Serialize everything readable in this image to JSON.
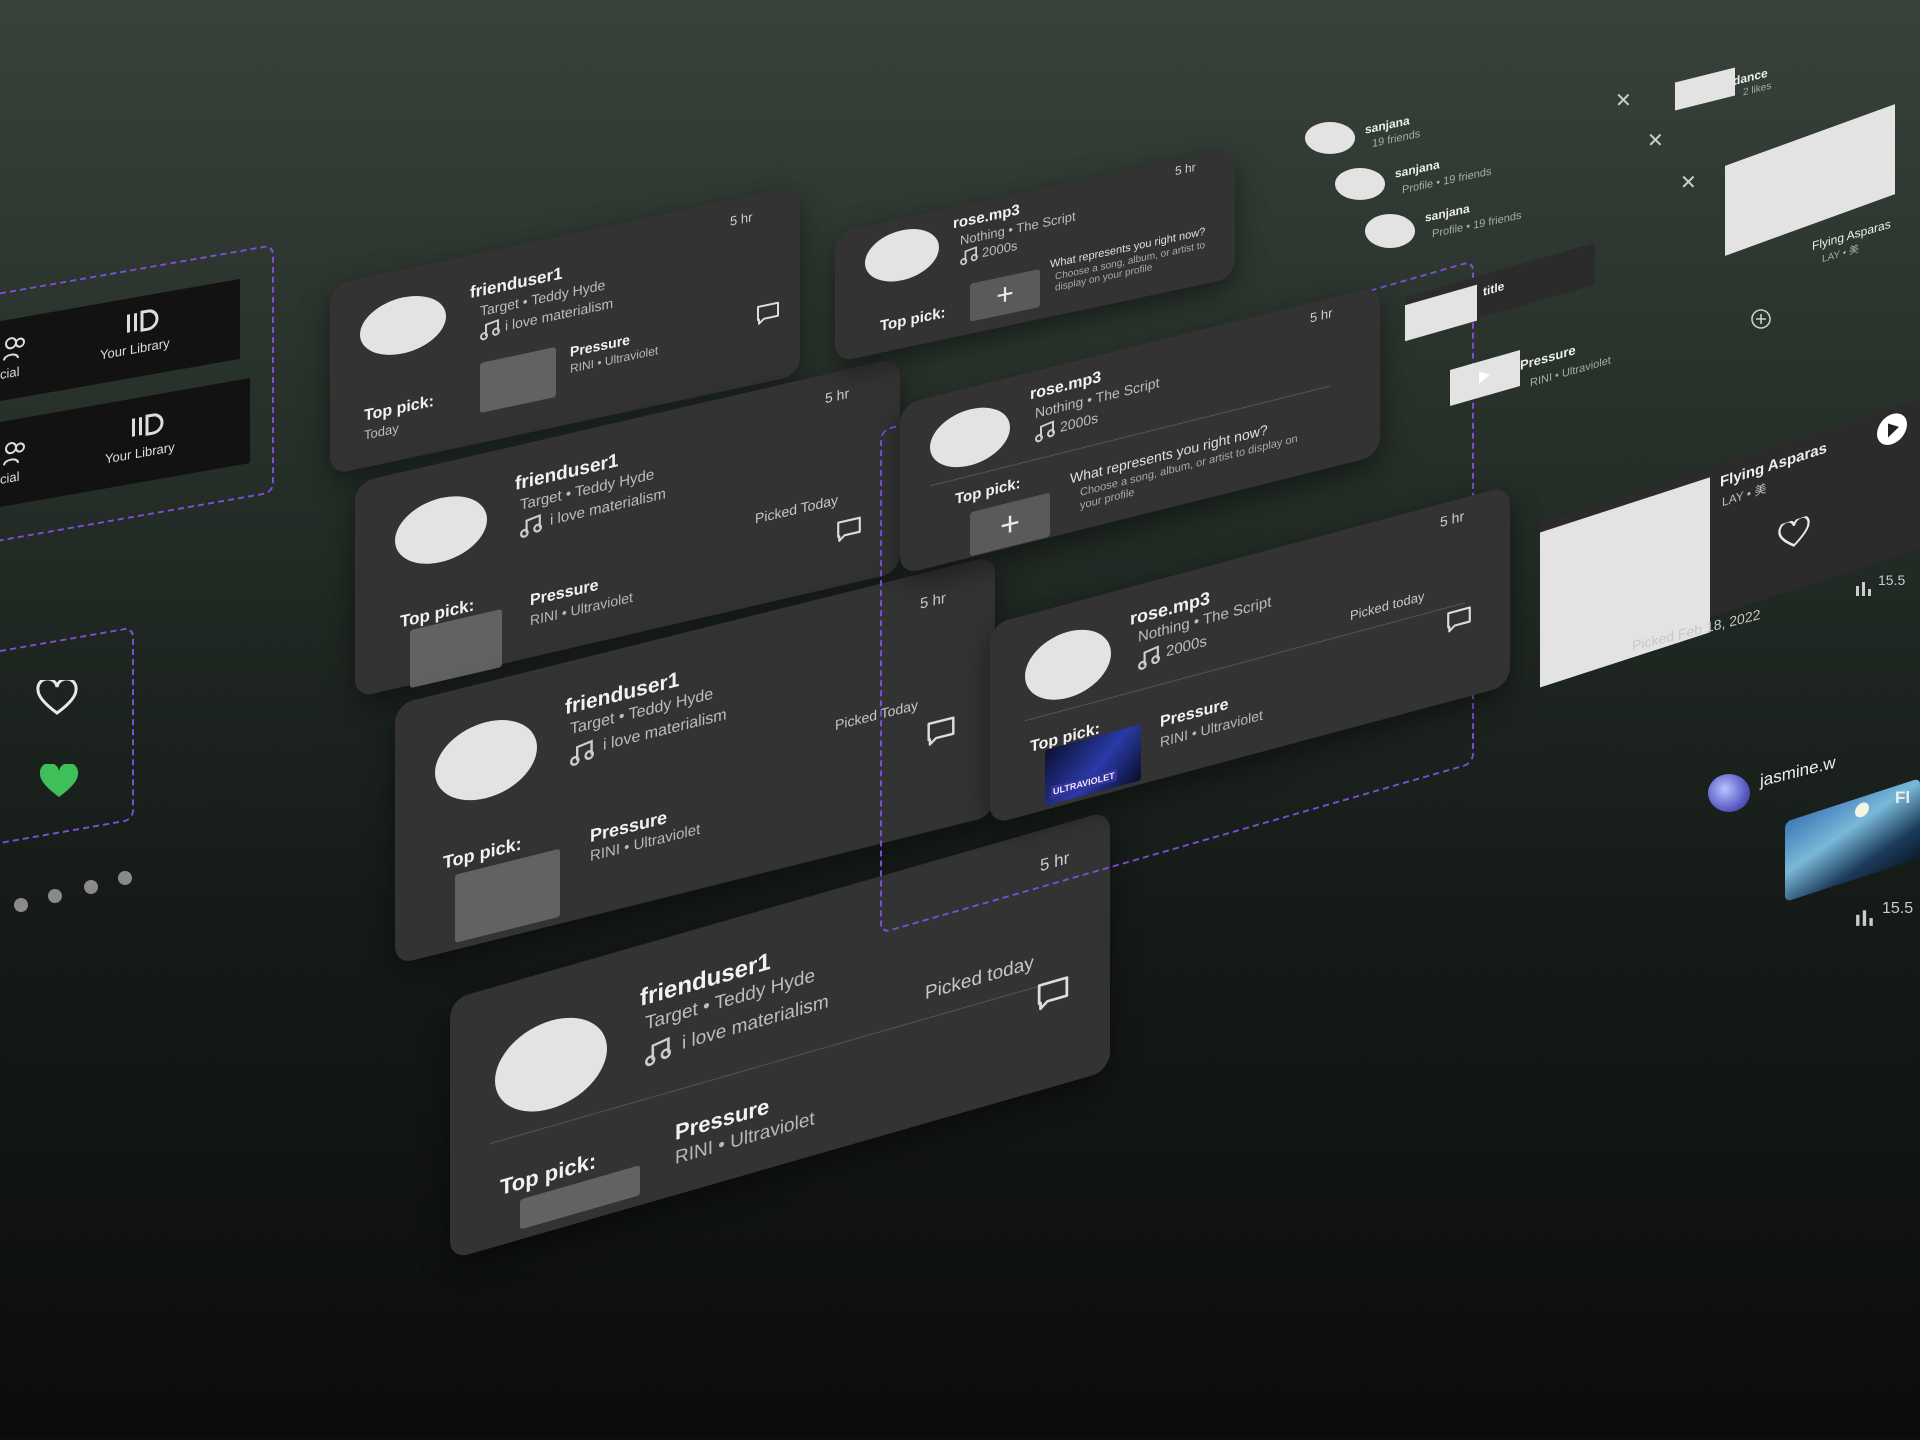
{
  "feed_cards": [
    {
      "username": "frienduser1",
      "subtitle": "Target • Teddy Hyde",
      "status": "i love materialism",
      "time": "5 hr",
      "top_pick_label": "Top pick:",
      "top_pick_sub": "Today",
      "song": "Pressure",
      "artist": "RINI • Ultraviolet",
      "picked": ""
    },
    {
      "username": "frienduser1",
      "subtitle": "Target • Teddy Hyde",
      "status": "i love materialism",
      "time": "5 hr",
      "top_pick_label": "Top pick:",
      "top_pick_sub": "",
      "song": "Pressure",
      "artist": "RINI • Ultraviolet",
      "picked": "Picked Today"
    },
    {
      "username": "frienduser1",
      "subtitle": "Target • Teddy Hyde",
      "status": "i love materialism",
      "time": "5 hr",
      "top_pick_label": "Top pick:",
      "top_pick_sub": "",
      "song": "Pressure",
      "artist": "RINI • Ultraviolet",
      "picked": "Picked Today"
    },
    {
      "username": "frienduser1",
      "subtitle": "Target • Teddy Hyde",
      "status": "i love materialism",
      "time": "5 hr",
      "top_pick_label": "Top pick:",
      "top_pick_sub": "",
      "song": "Pressure",
      "artist": "RINI • Ultraviolet",
      "picked": "Picked today"
    }
  ],
  "rose_cards": [
    {
      "username": "rose.mp3",
      "subtitle": "Nothing • The Script",
      "status": "2000s",
      "time": "5 hr",
      "top_pick_label": "Top pick:",
      "prompt_title": "What represents you right now?",
      "prompt_sub": "Choose a song, album, or artist to display on your profile"
    },
    {
      "username": "rose.mp3",
      "subtitle": "Nothing • The Script",
      "status": "2000s",
      "time": "5 hr",
      "top_pick_label": "Top pick:",
      "prompt_title": "What represents you right now?",
      "prompt_sub": "Choose a song, album, or artist to display on your profile"
    },
    {
      "username": "rose.mp3",
      "subtitle": "Nothing • The Script",
      "status": "2000s",
      "time": "5 hr",
      "top_pick_label": "Top pick:",
      "picked": "Picked today",
      "song": "Pressure",
      "artist": "RINI • Ultraviolet",
      "cover_text": "ULTRAVIOLET"
    }
  ],
  "nav": {
    "social_label": "cial",
    "library_label": "Your Library"
  },
  "friends": [
    {
      "name": "sanjana",
      "detail": "19 friends"
    },
    {
      "name": "sanjana",
      "detail": "Profile • 19 friends"
    },
    {
      "name": "sanjana",
      "detail": "Profile • 19 friends"
    }
  ],
  "playlist": {
    "name": "dance",
    "likes": "2 likes"
  },
  "album_tile": {
    "title": "Flying Asparas",
    "artist": "LAY • 美"
  },
  "title_chip": {
    "label": "title"
  },
  "mini_track": {
    "song": "Pressure",
    "artist": "RINI • Ultraviolet"
  },
  "feature": {
    "title": "Flying Asparas",
    "artist": "LAY • 美",
    "picked": "Picked Feb 18, 2022",
    "plays": "15.5"
  },
  "jasmine": {
    "username": "jasmine.w",
    "title_partial": "Fl",
    "plays": "15.5"
  },
  "icons": {
    "comment": "comment-icon",
    "heart": "heart-icon",
    "music": "music-note-icon",
    "plus": "plus-icon",
    "play": "play-icon"
  },
  "colors": {
    "accent_dashed": "#7a4fd6",
    "heart_liked": "#3fbf5a",
    "card_bg": "#333334"
  }
}
